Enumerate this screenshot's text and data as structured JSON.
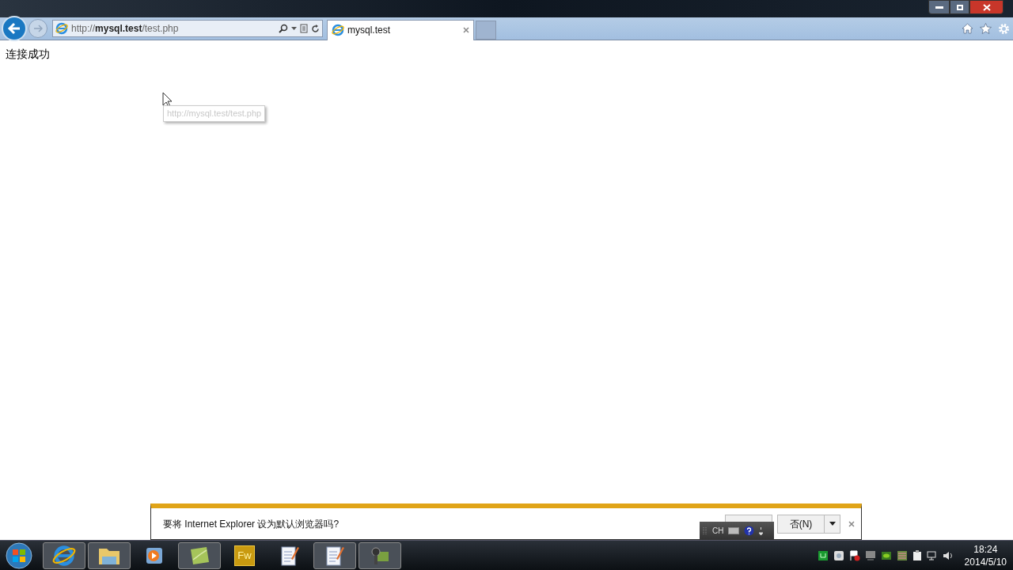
{
  "address_bar": {
    "url_prefix": "http://",
    "url_host": "mysql.test",
    "url_path": "/test.php"
  },
  "tabs": [
    {
      "title": "mysql.test",
      "selected": true
    }
  ],
  "page": {
    "text": "连接成功"
  },
  "tooltip": {
    "text": "http://mysql.test/test.php"
  },
  "notification": {
    "message": "要将 Internet Explorer 设为默认浏览器吗?",
    "no_button": "否(N)"
  },
  "language_bar": {
    "label": "CH"
  },
  "taskbar": {
    "apps": [
      {
        "kind": "ie",
        "active": true
      },
      {
        "kind": "folder",
        "active": true
      },
      {
        "kind": "media",
        "active": false
      },
      {
        "kind": "note",
        "active": true
      },
      {
        "kind": "fw",
        "label": "Fw",
        "active": false
      },
      {
        "kind": "notepad",
        "active": false
      },
      {
        "kind": "notepad",
        "active": true
      },
      {
        "kind": "tool",
        "active": true
      }
    ],
    "time": "18:24",
    "date": "2014/5/10"
  }
}
